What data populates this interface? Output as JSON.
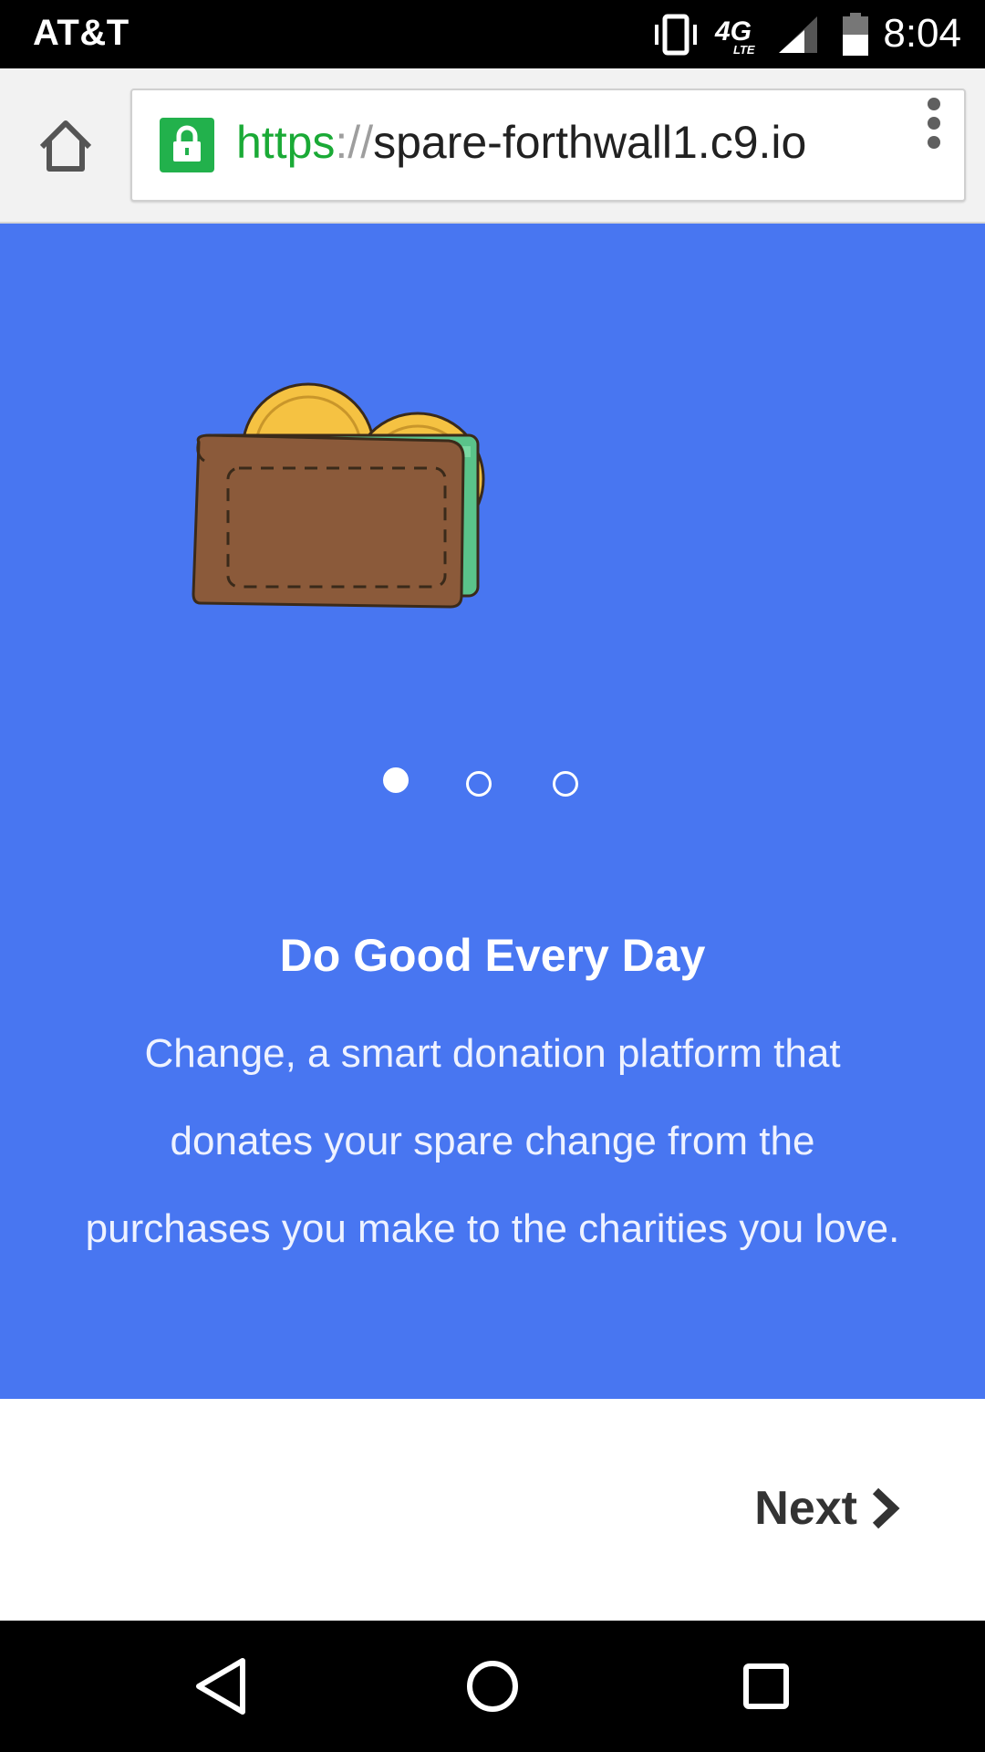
{
  "status_bar": {
    "carrier": "AT&T",
    "time": "8:04",
    "network_badge": "4G",
    "network_sub": "LTE",
    "icons": [
      "vibrate-icon",
      "network-4g-lte-icon",
      "signal-icon",
      "battery-icon"
    ]
  },
  "browser": {
    "url_scheme": "https",
    "url_separator": "://",
    "url_host": "spare-forthwall1.c9.io",
    "secure": true,
    "icons": [
      "home-icon",
      "lock-icon",
      "overflow-menu-icon"
    ]
  },
  "onboarding": {
    "illustration": "wallet-with-coins",
    "pager": {
      "total": 3,
      "active_index": 0
    },
    "title": "Do Good Every Day",
    "body": "Change, a smart donation platform that donates your spare change from the purchases you make to the charities you love."
  },
  "actions": {
    "next_label": "Next"
  },
  "colors": {
    "hero_background": "#4876f1",
    "secure_green": "#22b14c",
    "text_dark": "#333333"
  },
  "navigation_bar": {
    "icons": [
      "back-icon",
      "home-circle-icon",
      "recents-icon"
    ]
  }
}
